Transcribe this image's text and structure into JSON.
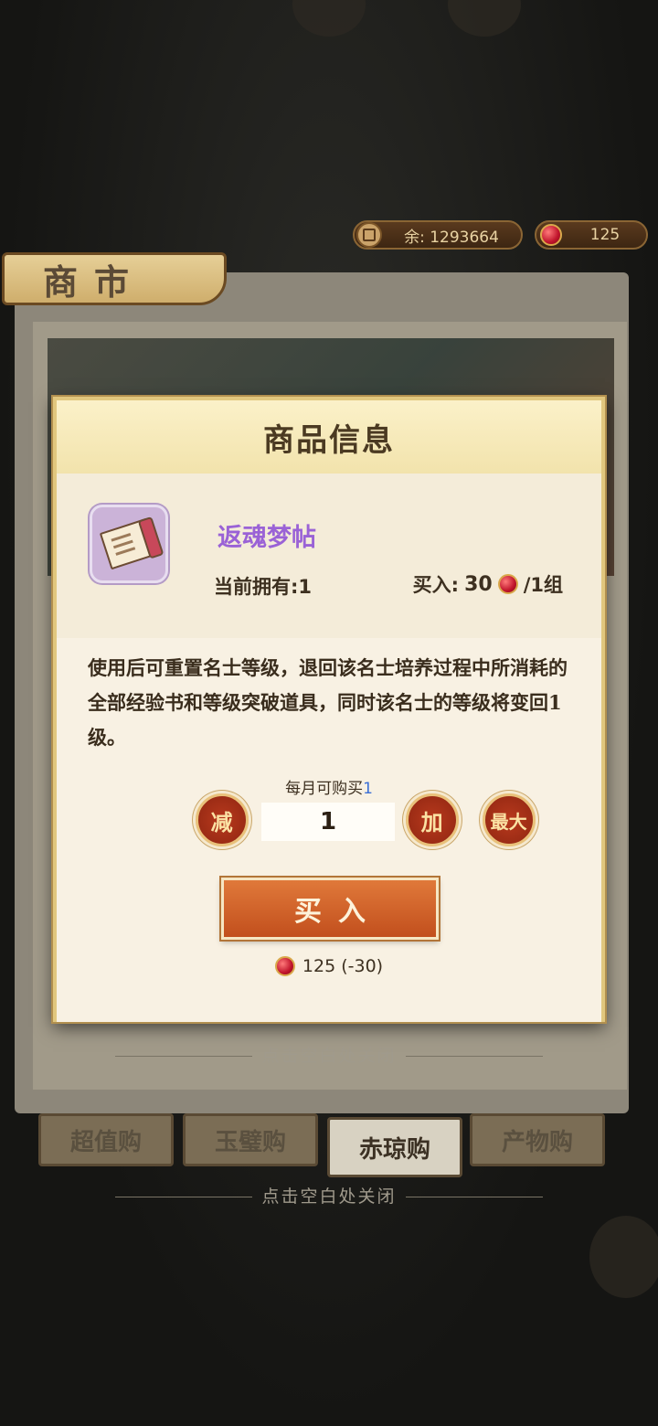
{
  "currency": {
    "silver": "余: 1293664",
    "gems": "125"
  },
  "shop": {
    "title": "商市",
    "tabs": [
      "超值购",
      "玉璧购",
      "赤琼购",
      "产物购"
    ],
    "active_tab": "赤琼购",
    "close_hint": "点击空白处关闭"
  },
  "dialog": {
    "title": "商品信息",
    "item_name": "返魂梦帖",
    "owned": "当前拥有:1",
    "price_label": "买入:",
    "price_value": "30",
    "price_unit": "/1组",
    "description": "使用后可重置名士等级，退回该名士培养过程中所消耗的全部经验书和等级突破道具，同时该名士的等级将变回1级。",
    "monthly_limit_label": "每月可购买",
    "monthly_limit_value": "1",
    "decrease_label": "减",
    "quantity": "1",
    "increase_label": "加",
    "max_label": "最大",
    "buy_label": "买入",
    "cost": "125 (-30)",
    "close_hint": "点击空白处关闭"
  },
  "colors": {
    "item_name": "#9a62d6",
    "buy_button": "#c95a22",
    "limit_number": "#3b6fd6"
  }
}
